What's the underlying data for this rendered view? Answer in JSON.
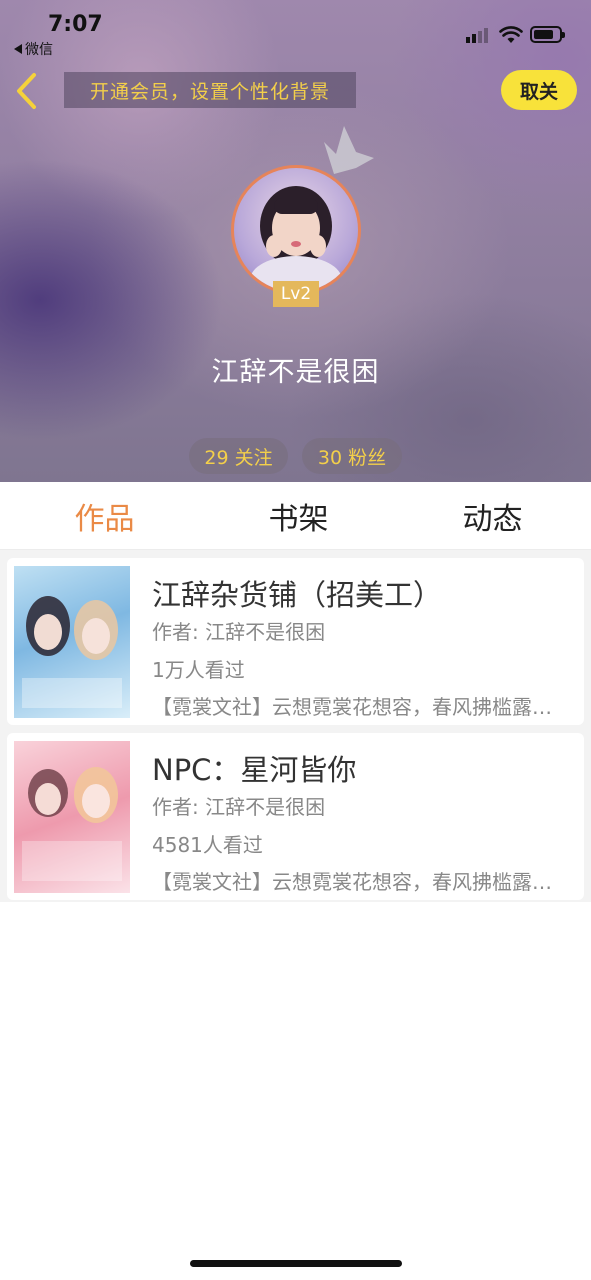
{
  "status_bar": {
    "time": "7:07",
    "back_app": "微信",
    "icons": [
      "signal-icon",
      "wifi-icon",
      "battery-icon"
    ]
  },
  "header": {
    "back_icon": "chevron-left-icon",
    "vip_banner": "开通会员，设置个性化背景",
    "follow_button": "取关"
  },
  "profile": {
    "avatar_icon": "avatar",
    "crown_icon": "crown-icon",
    "level": "Lv2",
    "username": "江辞不是很困",
    "following": "29 关注",
    "fans": "30 粉丝"
  },
  "tabs": [
    {
      "label": "作品",
      "active": true
    },
    {
      "label": "书架",
      "active": false
    },
    {
      "label": "动态",
      "active": false
    }
  ],
  "works": [
    {
      "title": "江辞杂货铺（招美工）",
      "author": "作者: 江辞不是很困",
      "views": "1万人看过",
      "description": "【霓裳文社】云想霓裳花想容，春风拂槛露华浓"
    },
    {
      "title": "NPC：星河皆你",
      "author": "作者: 江辞不是很困",
      "views": "4581人看过",
      "description": "【霓裳文社】云想霓裳花想容，春风拂槛露华浓"
    }
  ],
  "colors": {
    "accent_orange": "#ea8a46",
    "accent_yellow": "#f8e23a",
    "gold_text": "#f3cf4a",
    "level_badge": "#e4b85b"
  }
}
